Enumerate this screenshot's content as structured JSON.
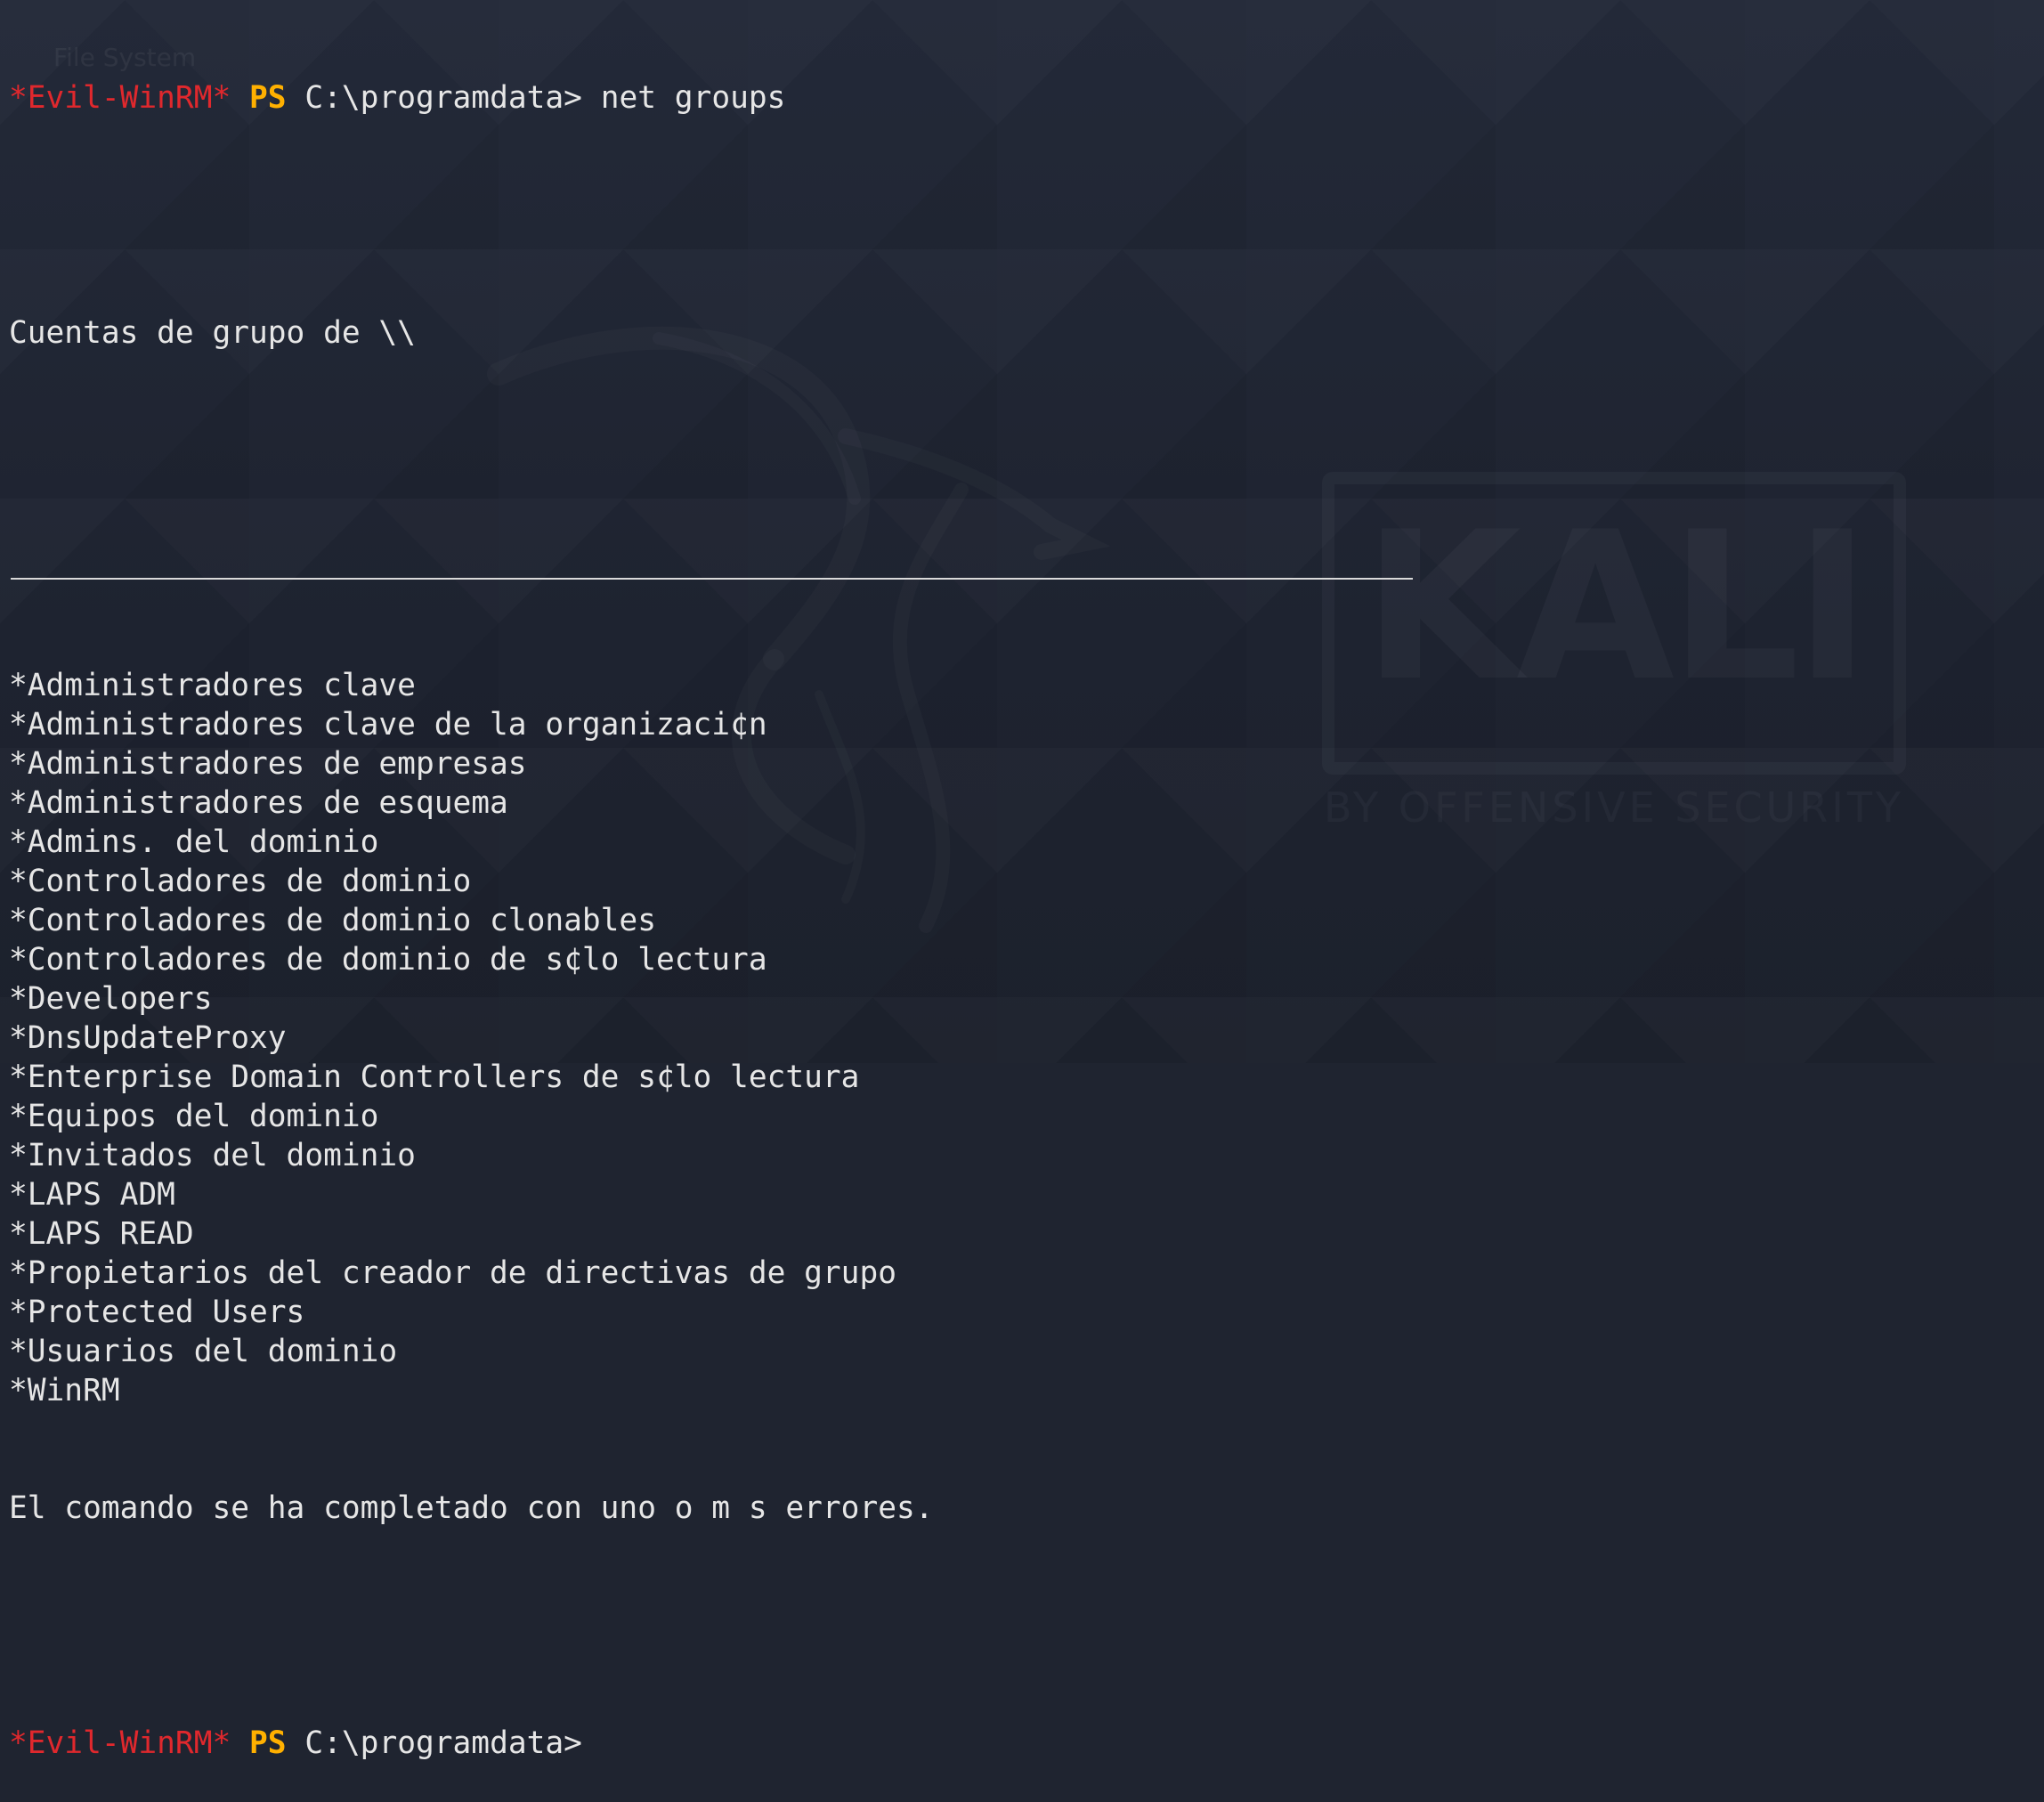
{
  "wallpaper": {
    "ghost_label": "File System",
    "logo_word": "KALI",
    "logo_tagline": "BY OFFENSIVE SECURITY"
  },
  "colors": {
    "background": "#1f2430",
    "text": "#e6e6e6",
    "prompt_shell": "#e0282d",
    "prompt_ps": "#ffb000"
  },
  "session1": {
    "shell": "*Evil-WinRM*",
    "ps": "PS",
    "path": "C:\\programdata>",
    "command": "net groups"
  },
  "header": "Cuentas de grupo de \\\\",
  "groups": [
    "*Administradores clave",
    "*Administradores clave de la organizaci¢n",
    "*Administradores de empresas",
    "*Administradores de esquema",
    "*Admins. del dominio",
    "*Controladores de dominio",
    "*Controladores de dominio clonables",
    "*Controladores de dominio de s¢lo lectura",
    "*Developers",
    "*DnsUpdateProxy",
    "*Enterprise Domain Controllers de s¢lo lectura",
    "*Equipos del dominio",
    "*Invitados del dominio",
    "*LAPS ADM",
    "*LAPS READ",
    "*Propietarios del creador de directivas de grupo",
    "*Protected Users",
    "*Usuarios del dominio",
    "*WinRM"
  ],
  "status": "El comando se ha completado con uno o m s errores.",
  "session2": {
    "shell": "*Evil-WinRM*",
    "ps": "PS",
    "path": "C:\\programdata>"
  }
}
